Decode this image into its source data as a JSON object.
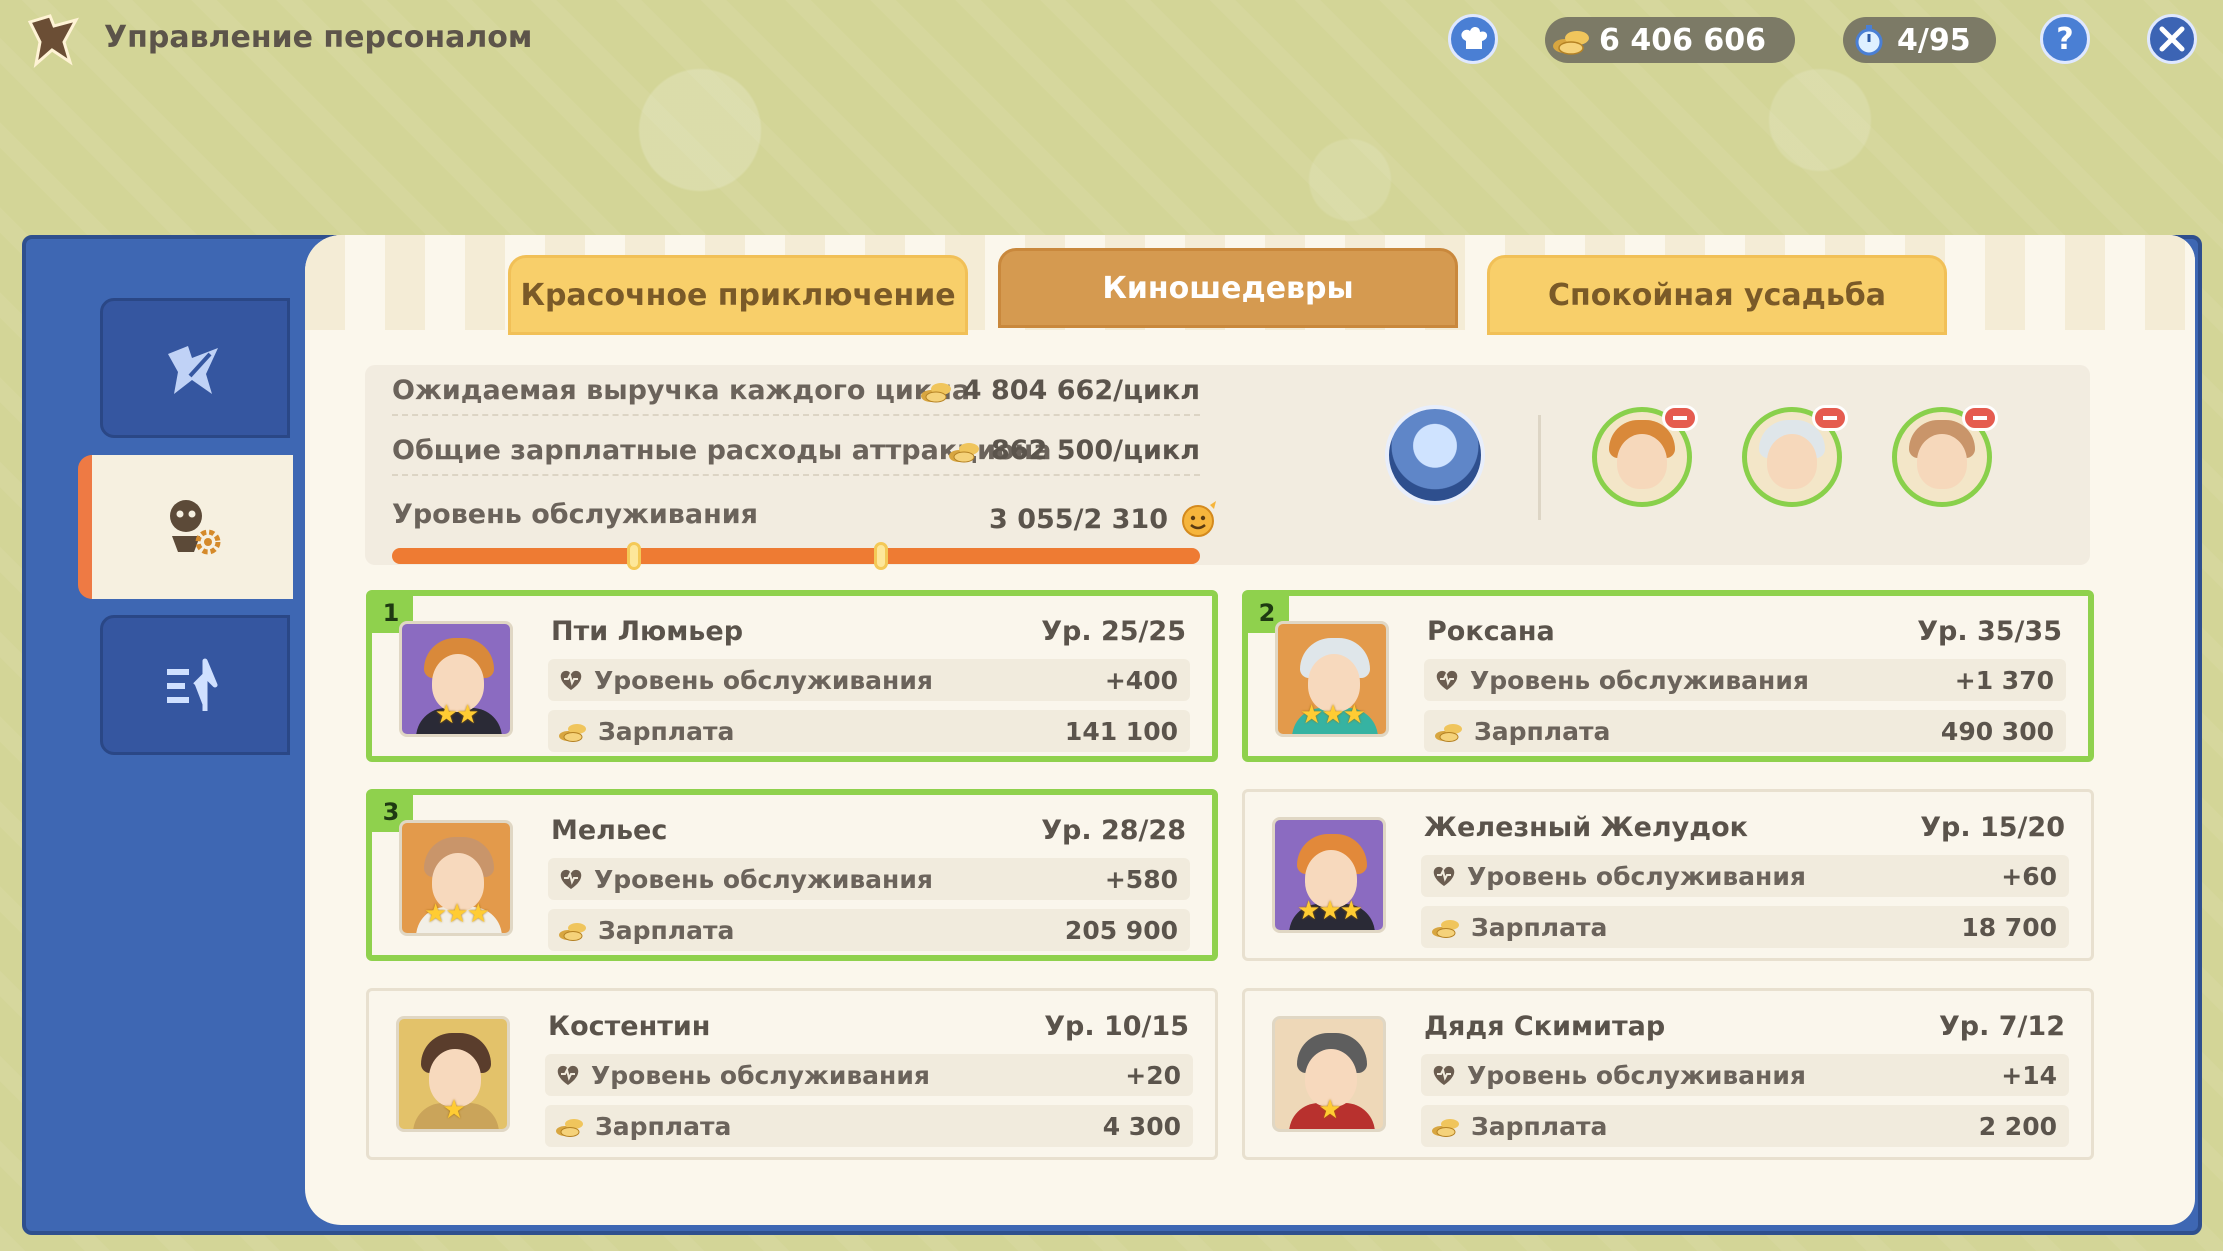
{
  "header": {
    "title": "Управление персоналом",
    "gold": "6 406 606",
    "timer": "4/95",
    "help_label": "?"
  },
  "tabs": [
    {
      "label": "Красочное приключение",
      "active": false
    },
    {
      "label": "Киношедевры",
      "active": true
    },
    {
      "label": "Спокойная усадьба",
      "active": false
    }
  ],
  "stats": {
    "revenue_label": "Ожидаемая выручка каждого цикла",
    "revenue_value": "4 804 662/цикл",
    "salary_label": "Общие зарплатные расходы аттракциона",
    "salary_value": "862 500/цикл",
    "service_label": "Уровень обслуживания",
    "service_value": "3 055/2 310"
  },
  "labels": {
    "service": "Уровень обслуживания",
    "salary": "Зарплата"
  },
  "staff": [
    {
      "slot": "1",
      "name": "Пти Люмьер",
      "level": "Ур. 25/25",
      "service": "+400",
      "salary": "141 100",
      "stars": "★★",
      "hair": "#d9893a",
      "body": "#2a2a36",
      "bg": "#8b6bc1"
    },
    {
      "slot": "2",
      "name": "Роксана",
      "level": "Ур. 35/35",
      "service": "+1 370",
      "salary": "490 300",
      "stars": "★★★",
      "hair": "#dfe6ea",
      "body": "#36b3a2",
      "bg": "#e39a4b"
    },
    {
      "slot": "3",
      "name": "Мельес",
      "level": "Ур. 28/28",
      "service": "+580",
      "salary": "205 900",
      "stars": "★★★",
      "hair": "#c9956a",
      "body": "#f2efe7",
      "bg": "#e39a4b"
    },
    {
      "slot": "",
      "name": "Железный Желудок",
      "level": "Ур. 15/20",
      "service": "+60",
      "salary": "18 700",
      "stars": "★★★",
      "hair": "#e2893a",
      "body": "#2a2a36",
      "bg": "#8b6bc1"
    },
    {
      "slot": "",
      "name": "Костентин",
      "level": "Ур. 10/15",
      "service": "+20",
      "salary": "4 300",
      "stars": "★",
      "hair": "#5a3d2c",
      "body": "#caa45a",
      "bg": "#e3c26a"
    },
    {
      "slot": "",
      "name": "Дядя Скимитар",
      "level": "Ур. 7/12",
      "service": "+14",
      "salary": "2 200",
      "stars": "★",
      "hair": "#5e5e5e",
      "body": "#b8312e",
      "bg": "#eed8b8"
    }
  ],
  "bar": {
    "marker1_fraction": 0.3,
    "marker2_fraction": 0.605
  },
  "colors": {
    "selected_border": "#8fd14d",
    "frame_blue": "#3e67b3",
    "active_tab": "#d59a50",
    "tab": "#f8cf6a",
    "bar": "#ee7b33"
  }
}
